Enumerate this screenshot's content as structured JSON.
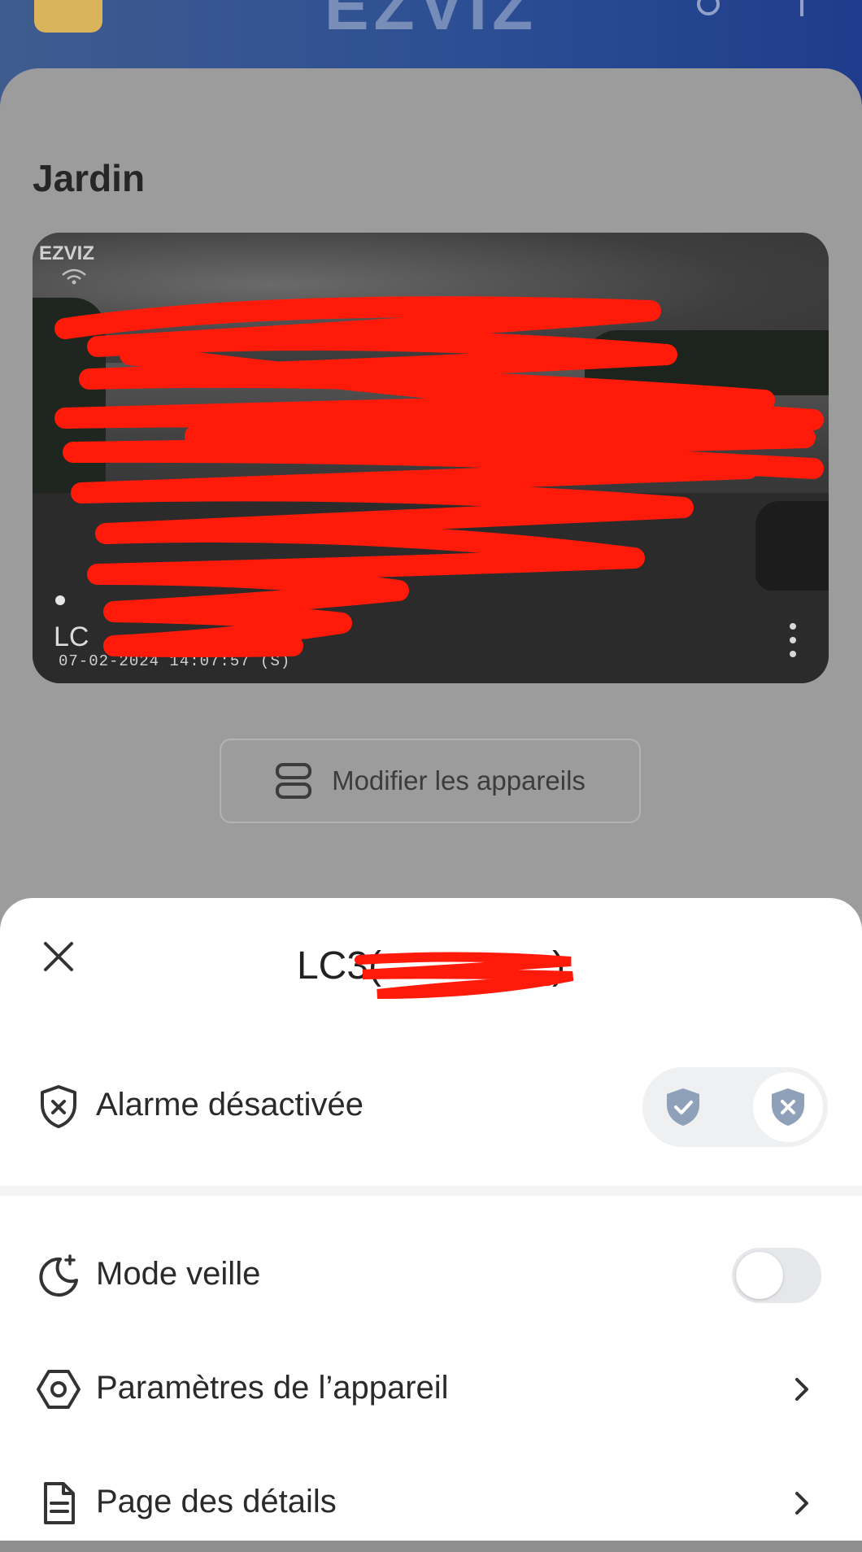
{
  "header": {
    "brand": "EZVIZ",
    "logo_icon": "app-logo",
    "search_icon": "search-icon",
    "add_icon": "plus-icon"
  },
  "group": {
    "title": "Jardin"
  },
  "camera": {
    "watermark": "EZVIZ",
    "name_visible": "LC",
    "timestamp": "07-02-2024 14:07:57 (S)",
    "more_icon": "more-vertical-icon"
  },
  "modify_button": {
    "label": "Modifier les appareils",
    "icon": "devices-icon"
  },
  "sheet": {
    "title": "LC3(",
    "title_suffix": ")",
    "close_icon": "close-icon",
    "rows": [
      {
        "label": "Alarme désactivée",
        "icon": "shield-x-icon",
        "control": "alarm-switch"
      },
      {
        "label": "Mode veille",
        "icon": "moon-icon",
        "control": "toggle",
        "enabled": false
      },
      {
        "label": "Paramètres de l’appareil",
        "icon": "settings-hexagon-icon",
        "control": "chevron"
      },
      {
        "label": "Page des détails",
        "icon": "document-icon",
        "control": "chevron"
      }
    ]
  },
  "colors": {
    "header_gradient_start": "#3f5c8f",
    "header_gradient_end": "#1f3c8c",
    "overlay_dim": "#8f8f8f",
    "sheet_bg": "#ffffff",
    "redaction": "#ff0000",
    "shield_icon": "#8fa1b8"
  }
}
